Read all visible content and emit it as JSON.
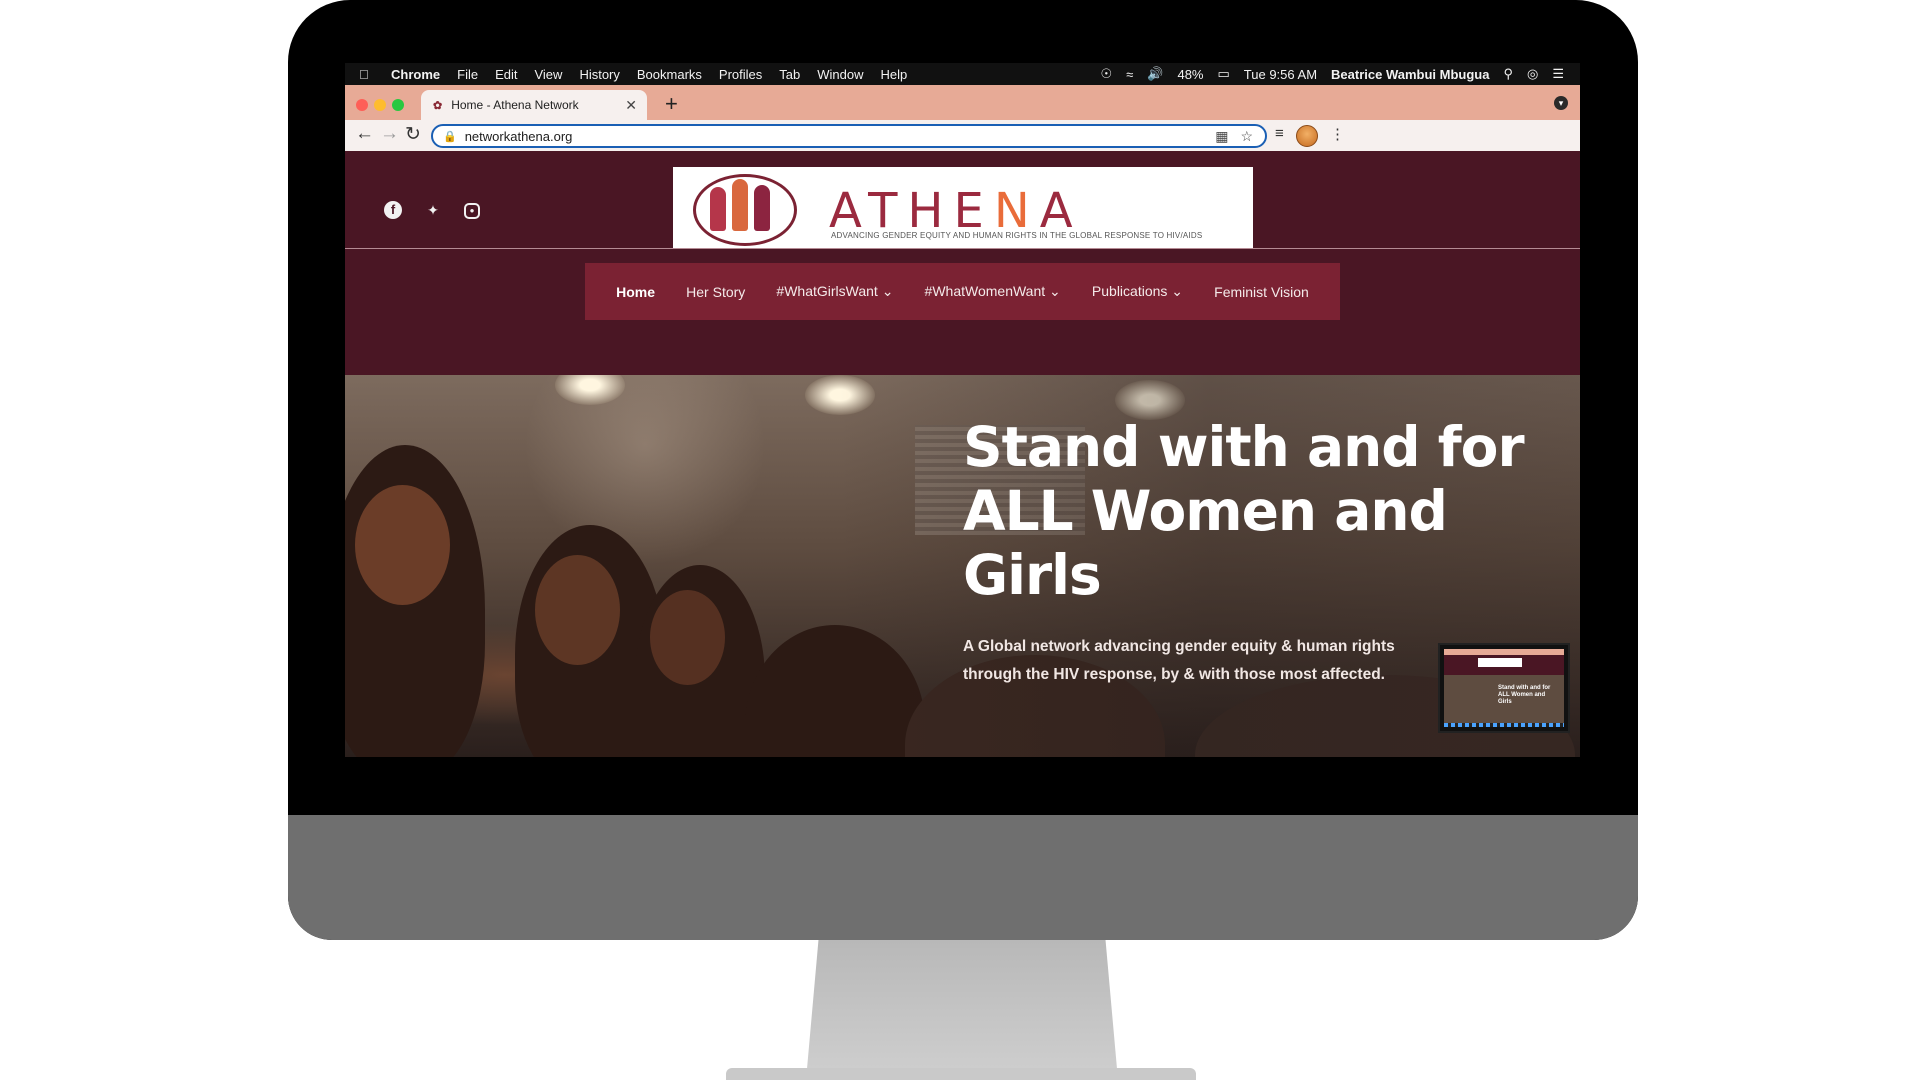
{
  "menubar": {
    "app": "Chrome",
    "items": [
      "File",
      "Edit",
      "View",
      "History",
      "Bookmarks",
      "Profiles",
      "Tab",
      "Window",
      "Help"
    ],
    "battery": "48%",
    "clock": "Tue 9:56 AM",
    "user": "Beatrice Wambui Mbugua"
  },
  "browser": {
    "tab_title": "Home - Athena Network",
    "url": "networkathena.org"
  },
  "site": {
    "logo": {
      "wordmark_start": "ATHE",
      "wordmark_accent": "N",
      "wordmark_end": "A",
      "tagline": "ADVANCING GENDER EQUITY AND HUMAN RIGHTS IN THE GLOBAL RESPONSE TO HIV/AIDS"
    },
    "nav": [
      {
        "label": "Home",
        "dropdown": false,
        "active": true
      },
      {
        "label": "Her Story",
        "dropdown": false,
        "active": false
      },
      {
        "label": "#WhatGirlsWant",
        "dropdown": true,
        "active": false
      },
      {
        "label": "#WhatWomenWant",
        "dropdown": true,
        "active": false
      },
      {
        "label": "Publications",
        "dropdown": true,
        "active": false
      },
      {
        "label": "Feminist Vision",
        "dropdown": false,
        "active": false
      }
    ],
    "hero": {
      "title": "Stand with and for ALL Women and Girls",
      "subtitle": "A Global network advancing gender equity & human rights through the HIV response, by & with those most affected."
    }
  },
  "colors": {
    "header_bg": "#4a1624",
    "nav_bg": "#7b2233",
    "tab_strip": "#e7aa96",
    "brand_red": "#9b2a3f",
    "brand_orange": "#e96c3a"
  }
}
